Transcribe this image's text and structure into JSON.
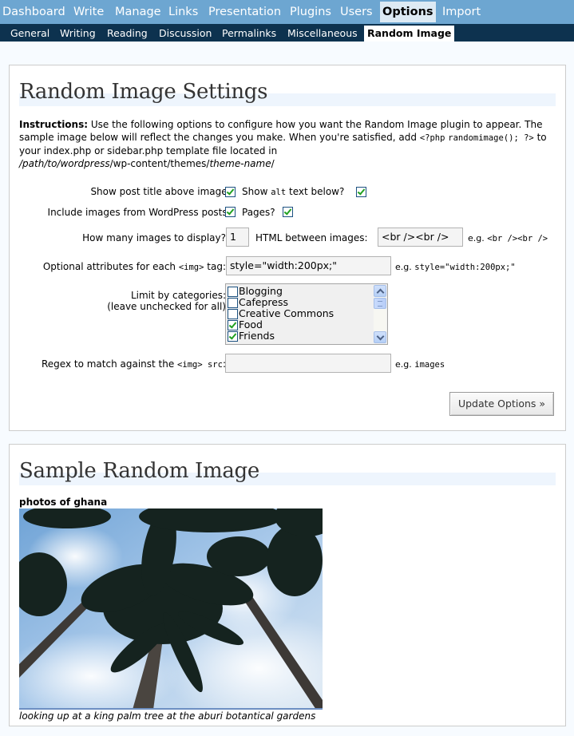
{
  "admin_menu": {
    "items": [
      {
        "label": "Dashboard"
      },
      {
        "label": "Write"
      },
      {
        "label": "Manage"
      },
      {
        "label": "Links"
      },
      {
        "label": "Presentation"
      },
      {
        "label": "Plugins"
      },
      {
        "label": "Users"
      },
      {
        "label": "Options",
        "current": true
      },
      {
        "label": "Import"
      }
    ]
  },
  "sub_menu": {
    "items": [
      {
        "label": "General"
      },
      {
        "label": "Writing"
      },
      {
        "label": "Reading"
      },
      {
        "label": "Discussion"
      },
      {
        "label": "Permalinks"
      },
      {
        "label": "Miscellaneous"
      },
      {
        "label": "Random Image",
        "current": true
      }
    ]
  },
  "settings": {
    "title": "Random Image Settings",
    "instructions": {
      "bold": "Instructions:",
      "text1": " Use the following options to configure how you want the Random Image plugin to appear. The sample image below will reflect the changes you make. When you're satisfied, add ",
      "code1": "<?php",
      "code2": "randomimage(); ?>",
      "text2": " to your index.php or sidebar.php template file located in ",
      "path_italic1": "/path/to/wordpress",
      "path_plain": "/wp-content/themes/",
      "path_italic2": "theme-name",
      "path_end": "/"
    },
    "show_post_title": {
      "label": "Show post title above image?",
      "checked": true
    },
    "show_alt_text": {
      "label_pre": "Show ",
      "label_code": "alt",
      "label_post": " text below?",
      "checked": true
    },
    "include_posts": {
      "label": "Include images from WordPress posts?",
      "checked": true
    },
    "include_pages": {
      "label": "Pages?",
      "checked": true
    },
    "num_images": {
      "label": "How many images to display?",
      "value": "1"
    },
    "html_between": {
      "label": "HTML between images:",
      "value": "<br /><br />",
      "example_prefix": "e.g. ",
      "example": "<br /><br />"
    },
    "img_attributes": {
      "label_pre": "Optional attributes for each ",
      "label_code": "<img>",
      "label_post": " tag:",
      "value": "style=\"width:200px;\"",
      "example_prefix": "e.g. ",
      "example": "style=\"width:200px;\""
    },
    "categories": {
      "label": "Limit by categories:",
      "sublabel": "(leave unchecked for all)",
      "items": [
        {
          "name": "Blogging",
          "checked": false
        },
        {
          "name": "Cafepress",
          "checked": false
        },
        {
          "name": "Creative Commons",
          "checked": false
        },
        {
          "name": "Food",
          "checked": true
        },
        {
          "name": "Friends",
          "checked": true
        }
      ]
    },
    "regex": {
      "label_pre": "Regex to match against the ",
      "label_code": "<img> src",
      "label_post": ":",
      "value": "",
      "example_prefix": "e.g. ",
      "example": "images"
    },
    "update_button": "Update Options »"
  },
  "sample": {
    "title": "Sample Random Image",
    "post_title": "photos of ghana",
    "image_alt": "looking up at a king palm tree at the aburi botantical gardens",
    "caption": "looking up at a king palm tree at the aburi botantical gardens"
  }
}
